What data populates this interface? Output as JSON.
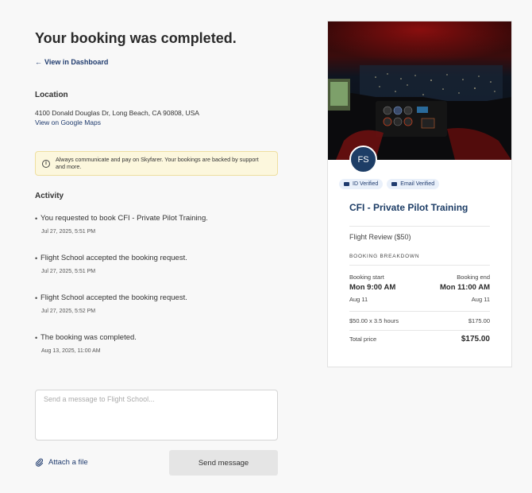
{
  "header": {
    "title": "Your booking was completed.",
    "dashboard_link": "View in Dashboard",
    "back_arrow": "←"
  },
  "location": {
    "heading": "Location",
    "address": "4100 Donald Douglas Dr, Long Beach, CA 90808, USA",
    "maps_link": "View on Google Maps"
  },
  "notice": {
    "icon": "info-icon",
    "icon_glyph": "i",
    "text": "Always communicate and pay on Skyfarer. Your bookings are backed by support and more."
  },
  "activity": {
    "heading": "Activity",
    "items": [
      {
        "bullet": "•",
        "text": "You requested to book CFI - Private Pilot Training.",
        "time": "Jul 27, 2025, 5:51 PM"
      },
      {
        "bullet": "•",
        "text": "Flight School accepted the booking request.",
        "time": "Jul 27, 2025, 5:51 PM"
      },
      {
        "bullet": "•",
        "text": "Flight School accepted the booking request.",
        "time": "Jul 27, 2025, 5:52 PM"
      },
      {
        "bullet": "•",
        "text": "The booking was completed.",
        "time": "Aug 13, 2025, 11:00 AM"
      }
    ]
  },
  "message": {
    "placeholder": "Send a message to Flight School...",
    "attach_label": "Attach a file",
    "send_label": "Send message"
  },
  "card": {
    "avatar_initials": "FS",
    "badges": [
      "ID Verified",
      "Email Verified"
    ],
    "title": "CFI - Private Pilot Training",
    "service": "Flight Review ($50)",
    "breakdown_label": "BOOKING BREAKDOWN",
    "start_label": "Booking start",
    "end_label": "Booking end",
    "start_time": "Mon 9:00 AM",
    "end_time": "Mon 11:00 AM",
    "start_date": "Aug 11",
    "end_date": "Aug 11",
    "line_item_label": "$50.00 x 3.5 hours",
    "line_item_value": "$175.00",
    "total_label": "Total price",
    "total_value": "$175.00"
  },
  "colors": {
    "accent": "#1f3b6e",
    "avatar_bg": "#1d3d66",
    "notice_bg": "#fcf7dd",
    "send_button_bg": "#e5e5e5"
  }
}
